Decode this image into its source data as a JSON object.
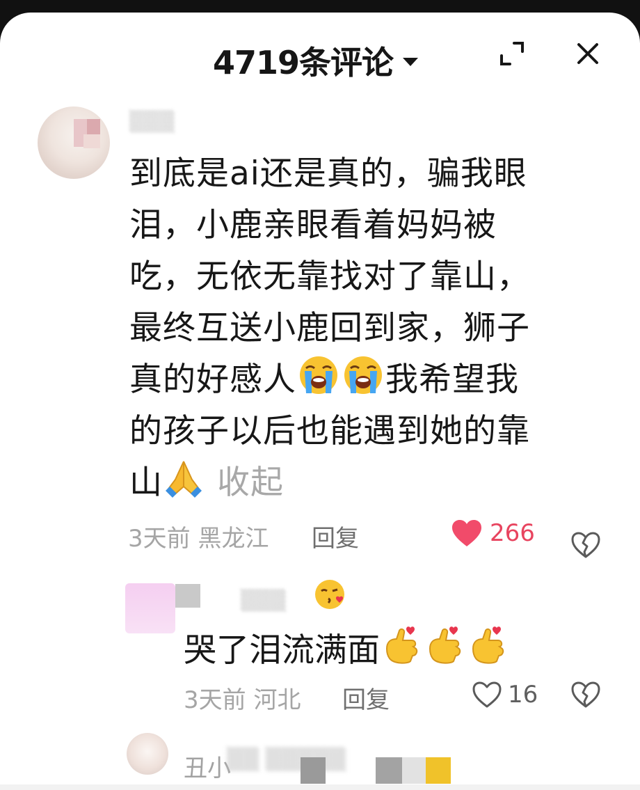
{
  "header": {
    "title": "4719条评论",
    "icons": [
      "chevron-down-icon",
      "expand-icon",
      "close-icon"
    ]
  },
  "comments": [
    {
      "text_lines": [
        "到底是ai还是真的，骗我眼",
        "泪，小鹿亲眼看着妈妈被",
        "吃，无依无靠找对了靠山，",
        "最终互送小鹿回到家，狮子",
        "真的好感人",
        "我希望我",
        "的孩子以后也能遇到她的靠",
        "山"
      ],
      "emojis": [
        "loudly-crying-face",
        "loudly-crying-face",
        "folded-hands"
      ],
      "collapse_label": "收起",
      "time": "3天前 黑龙江",
      "reply_label": "回复",
      "likes": "266",
      "liked": true,
      "replies": [
        {
          "text": "哭了泪流满面",
          "emojis": [
            "face-blowing-kiss",
            "hand-with-index-finger-and-thumb-crossed",
            "hand-with-index-finger-and-thumb-crossed",
            "hand-with-index-finger-and-thumb-crossed"
          ],
          "time": "3天前 河北",
          "reply_label": "回复",
          "likes": "16",
          "liked": false
        }
      ]
    },
    {
      "username_partial": "丑小"
    }
  ],
  "colors": {
    "like_active": "#f14b6a",
    "text_primary": "#171717",
    "text_secondary": "#a5a5a5"
  }
}
